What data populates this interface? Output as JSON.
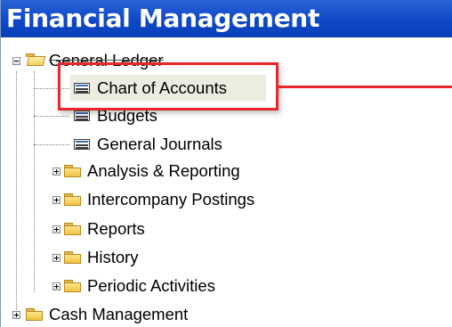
{
  "header": {
    "title": "Financial Management"
  },
  "tree": {
    "general_ledger": "General Ledger",
    "chart_of_accounts": "Chart of Accounts",
    "budgets": "Budgets",
    "general_journals": "General Journals",
    "analysis_reporting": "Analysis & Reporting",
    "intercompany_postings": "Intercompany Postings",
    "reports": "Reports",
    "history": "History",
    "periodic_activities": "Periodic Activities",
    "cash_management": "Cash Management"
  },
  "colors": {
    "header_bg": "#0e48c8",
    "highlight": "#e8262c",
    "selection_bg": "#ecece0"
  },
  "icons": [
    "expander-icon",
    "folder-icon",
    "open-folder-icon",
    "list-icon"
  ]
}
